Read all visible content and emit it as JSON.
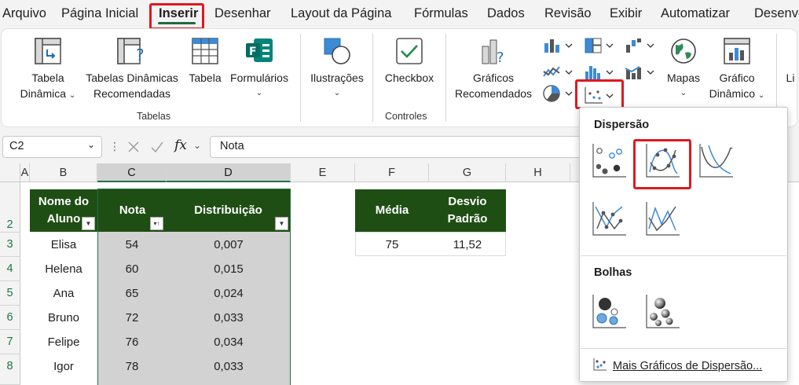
{
  "menu": {
    "tabs": [
      "Arquivo",
      "Página Inicial",
      "Inserir",
      "Desenhar",
      "Layout da Página",
      "Fórmulas",
      "Dados",
      "Revisão",
      "Exibir",
      "Automatizar",
      "Desenvo"
    ]
  },
  "ribbon": {
    "tabela_dinamica": [
      "Tabela",
      "Dinâmica"
    ],
    "tabelas_recomendadas": [
      "Tabelas Dinâmicas",
      "Recomendadas"
    ],
    "tabela": "Tabela",
    "formularios": "Formulários",
    "ilustracoes": "Ilustrações",
    "checkbox": "Checkbox",
    "graficos_recomendados": [
      "Gráficos",
      "Recomendados"
    ],
    "mapas": "Mapas",
    "grafico_dinamico": [
      "Gráfico",
      "Dinâmico"
    ],
    "cut_label": "Li",
    "group_tabelas": "Tabelas",
    "group_controles": "Controles"
  },
  "formula_bar": {
    "name_box": "C2",
    "fx": "fx",
    "value": "Nota"
  },
  "columns": [
    "A",
    "B",
    "C",
    "D",
    "E",
    "F",
    "G",
    "H"
  ],
  "rows": [
    "2",
    "3",
    "4",
    "5",
    "6",
    "7",
    "8"
  ],
  "table": {
    "headers": [
      "Nome do Aluno",
      "Nota",
      "Distribuição"
    ],
    "rows": [
      [
        "Elisa",
        "54",
        "0,007"
      ],
      [
        "Helena",
        "60",
        "0,015"
      ],
      [
        "Ana",
        "65",
        "0,024"
      ],
      [
        "Bruno",
        "72",
        "0,033"
      ],
      [
        "Felipe",
        "76",
        "0,034"
      ],
      [
        "Igor",
        "78",
        "0,033"
      ]
    ]
  },
  "stats": {
    "headers": [
      "Média",
      "Desvio Padrão"
    ],
    "values": [
      "75",
      "11,52"
    ]
  },
  "dropdown": {
    "section_scatter": "Dispersão",
    "section_bubbles": "Bolhas",
    "more": "Mais Gráficos de Dispersão..."
  },
  "colors": {
    "header_fill": "#1f4e14",
    "selection_fill": "#d2d2d2",
    "highlight": "#e0181f",
    "accent": "#217346"
  }
}
